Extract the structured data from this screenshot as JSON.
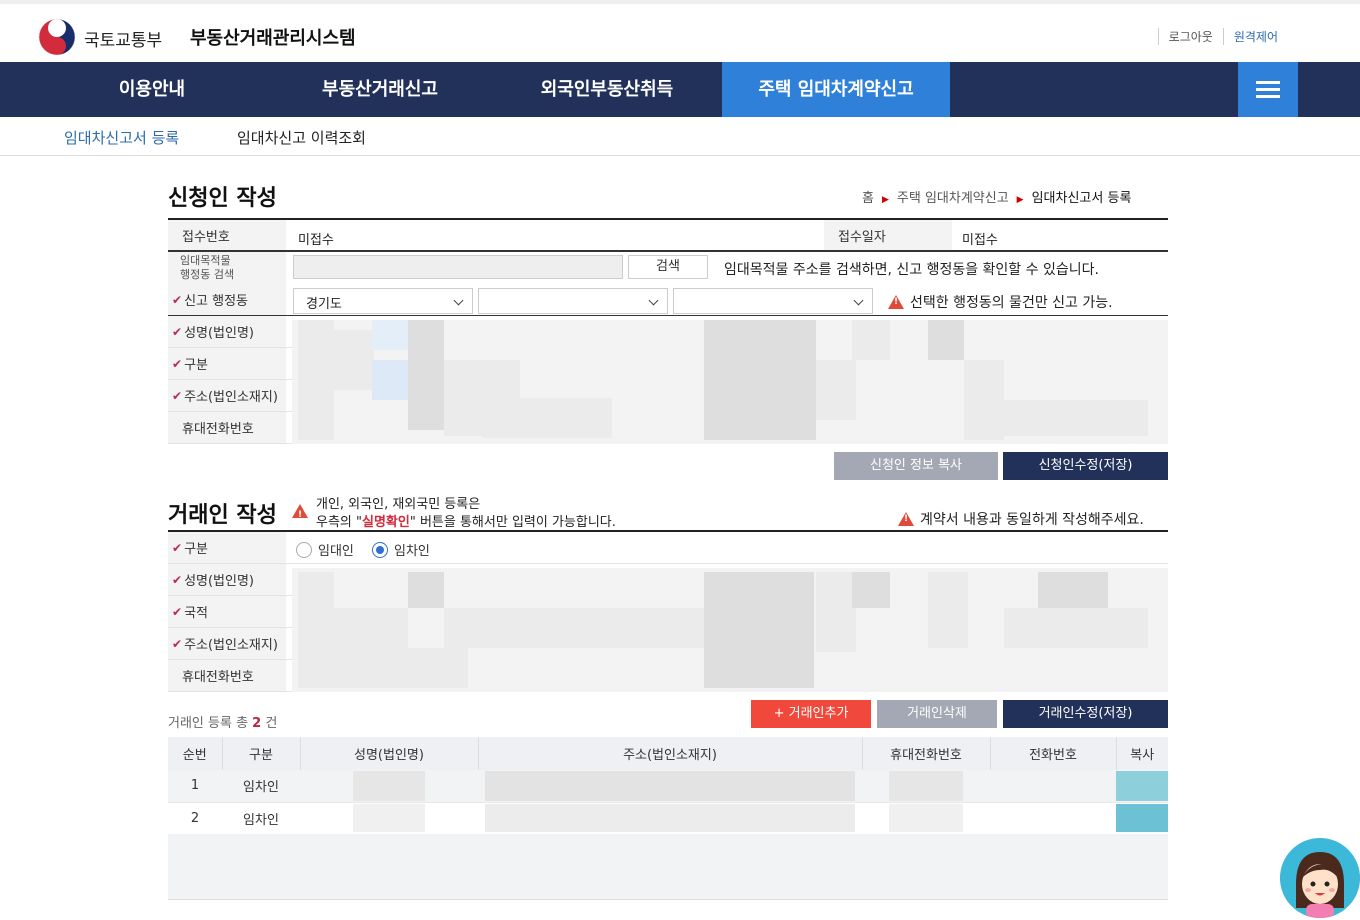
{
  "header": {
    "ministry": "국토교통부",
    "system": "부동산거래관리시스템",
    "logout": "로그아웃",
    "remote": "원격제어"
  },
  "nav": {
    "items": [
      "이용안내",
      "부동산거래신고",
      "외국인부동산취득",
      "주택 임대차계약신고"
    ],
    "active_index": 3
  },
  "subnav": {
    "register": "임대차신고서 등록",
    "history": "임대차신고 이력조회"
  },
  "applicant": {
    "title": "신청인 작성",
    "breadcrumb": [
      "홈",
      "주택 임대차계약신고",
      "임대차신고서 등록"
    ],
    "receipt_no_label": "접수번호",
    "receipt_no_value": "미접수",
    "receipt_date_label": "접수일자",
    "receipt_date_value": "미접수",
    "search_label": "임대목적물\n행정동 검색",
    "search_button": "검색",
    "search_notice": "임대목적물 주소를 검색하면, 신고 행정동을 확인할 수 있습니다.",
    "district_label": "신고 행정동",
    "district_selects": [
      "경기도",
      "",
      ""
    ],
    "district_notice": "선택한 행정동의 물건만 신고 가능.",
    "name_label": "성명(법인명)",
    "type_label": "구분",
    "address_label": "주소(법인소재지)",
    "phone_label": "휴대전화번호",
    "copy_button": "신청인 정보 복사",
    "save_button": "신청인수정(저장)"
  },
  "party": {
    "title": "거래인 작성",
    "notice_line1": "개인, 외국인, 재외국민 등록은",
    "notice_line2_pre": "우측의 \"",
    "notice_line2_red": "실명확인",
    "notice_line2_post": "\" 버튼을 통해서만 입력이 가능합니다.",
    "notice_right": "계약서 내용과 동일하게 작성해주세요.",
    "type_label": "구분",
    "radio_lessor": "임대인",
    "radio_lessee": "임차인",
    "radio_selected": "임차인",
    "name_label": "성명(법인명)",
    "nationality_label": "국적",
    "address_label": "주소(법인소재지)",
    "phone_label": "휴대전화번호",
    "count_prefix": "거래인 등록 총",
    "count": "2",
    "count_suffix": "건",
    "add_button": "+ 거래인추가",
    "delete_button": "거래인삭제",
    "save_button": "거래인수정(저장)"
  },
  "table": {
    "headers": [
      "순번",
      "구분",
      "성명(법인명)",
      "주소(법인소재지)",
      "휴대전화번호",
      "전화번호",
      "복사"
    ],
    "rows": [
      {
        "no": "1",
        "type": "임차인"
      },
      {
        "no": "2",
        "type": "임차인"
      }
    ]
  },
  "colors": {
    "nav_bg": "#22315a",
    "nav_active": "#2f80d9",
    "btn_navy": "#22315a",
    "btn_red": "#f0483a",
    "btn_gray": "#a3a8b4",
    "required_mark": "#c0245d",
    "warning": "#e04a3a"
  }
}
